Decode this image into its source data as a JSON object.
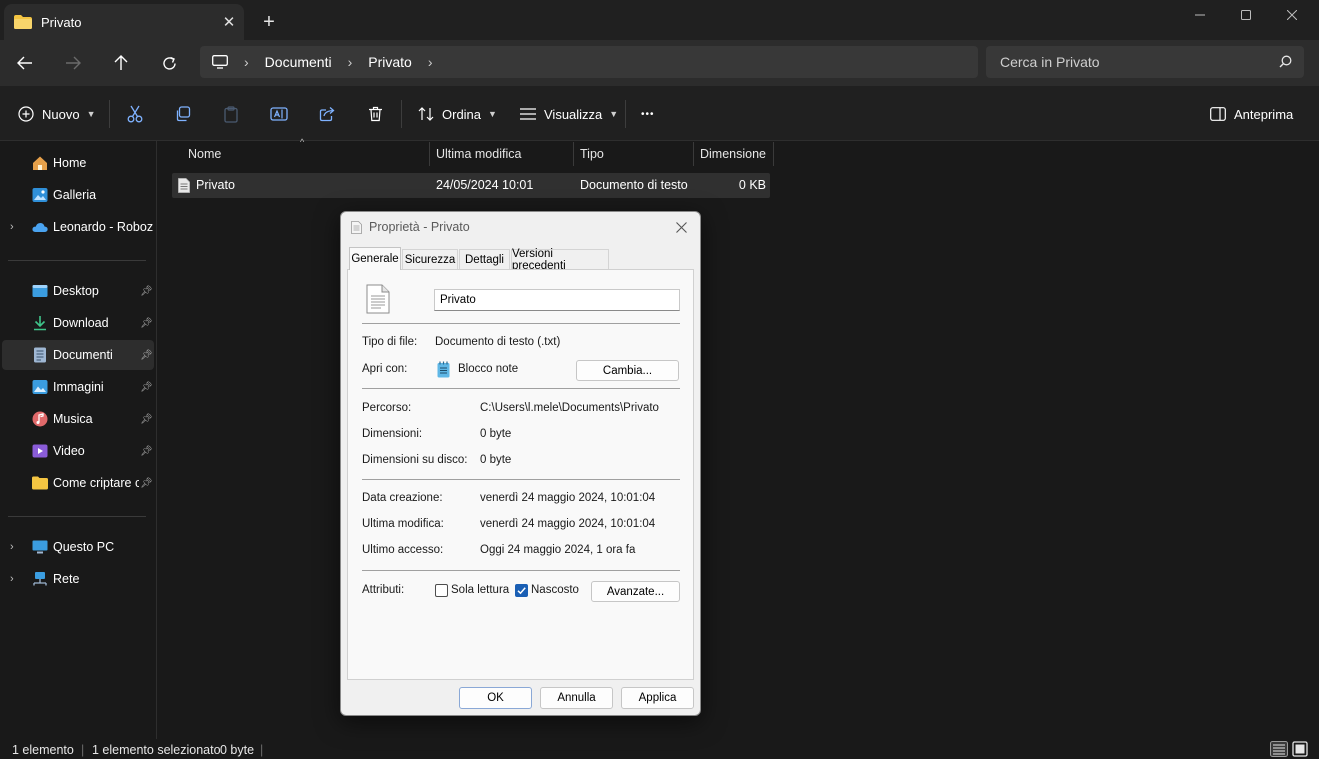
{
  "window": {
    "tab_title": "Privato",
    "close_tab": "✕",
    "new_tab": "+"
  },
  "address": {
    "crumbs": [
      "Documenti",
      "Privato"
    ],
    "separator": "›"
  },
  "search": {
    "placeholder": "Cerca in Privato"
  },
  "commandbar": {
    "new_label": "Nuovo",
    "sort_label": "Ordina",
    "view_label": "Visualizza",
    "more_label": "•••",
    "preview_label": "Anteprima"
  },
  "sidebar": {
    "items": [
      {
        "label": "Home"
      },
      {
        "label": "Galleria"
      },
      {
        "label": "Leonardo - Roboze"
      },
      {
        "label": "Desktop"
      },
      {
        "label": "Download"
      },
      {
        "label": "Documenti"
      },
      {
        "label": "Immagini"
      },
      {
        "label": "Musica"
      },
      {
        "label": "Video"
      },
      {
        "label": "Come criptare c"
      },
      {
        "label": "Questo PC"
      },
      {
        "label": "Rete"
      }
    ]
  },
  "filelist": {
    "columns": [
      "Nome",
      "Ultima modifica",
      "Tipo",
      "Dimensione"
    ],
    "rows": [
      {
        "name": "Privato",
        "modified": "24/05/2024 10:01",
        "type": "Documento di testo",
        "size": "0 KB"
      }
    ]
  },
  "status": {
    "count": "1 elemento",
    "selected": "1 elemento selezionato",
    "size": "0 byte"
  },
  "dialog": {
    "title": "Proprietà - Privato",
    "tabs": [
      "Generale",
      "Sicurezza",
      "Dettagli",
      "Versioni precedenti"
    ],
    "filename": "Privato",
    "file_type_label": "Tipo di file:",
    "file_type_value": "Documento di testo (.txt)",
    "open_with_label": "Apri con:",
    "open_with_value": "Blocco note",
    "change_button": "Cambia...",
    "path_label": "Percorso:",
    "path_value": "C:\\Users\\l.mele\\Documents\\Privato",
    "size_label": "Dimensioni:",
    "size_value": "0 byte",
    "disk_size_label": "Dimensioni su disco:",
    "disk_size_value": "0 byte",
    "created_label": "Data creazione:",
    "created_value": "venerdì 24 maggio 2024, 10:01:04",
    "modified_label": "Ultima modifica:",
    "modified_value": "venerdì 24 maggio 2024, 10:01:04",
    "accessed_label": "Ultimo accesso:",
    "accessed_value": "Oggi 24 maggio 2024, 1 ora fa",
    "attributes_label": "Attributi:",
    "readonly_label": "Sola lettura",
    "readonly_checked": false,
    "hidden_label": "Nascosto",
    "hidden_checked": true,
    "advanced_button": "Avanzate...",
    "ok_button": "OK",
    "cancel_button": "Annulla",
    "apply_button": "Applica"
  },
  "colors": {
    "folder": "#f4c542",
    "accent": "#1a5fb4",
    "onedrive": "#4aa3f0"
  }
}
